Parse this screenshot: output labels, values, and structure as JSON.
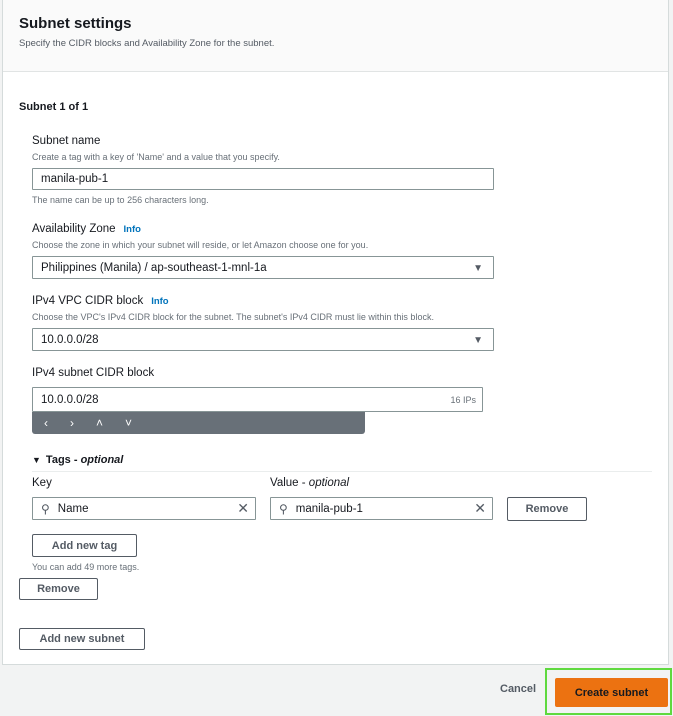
{
  "header": {
    "title": "Subnet settings",
    "description": "Specify the CIDR blocks and Availability Zone for the subnet."
  },
  "subnet": {
    "heading": "Subnet 1 of 1",
    "name": {
      "label": "Subnet name",
      "description": "Create a tag with a key of 'Name' and a value that you specify.",
      "value": "manila-pub-1",
      "hint": "The name can be up to 256 characters long."
    },
    "az": {
      "label": "Availability Zone",
      "info": "Info",
      "description": "Choose the zone in which your subnet will reside, or let Amazon choose one for you.",
      "value": "Philippines (Manila) / ap-southeast-1-mnl-1a"
    },
    "vpc_cidr": {
      "label": "IPv4 VPC CIDR block",
      "info": "Info",
      "description": "Choose the VPC's IPv4 CIDR block for the subnet. The subnet's IPv4 CIDR must lie within this block.",
      "value": "10.0.0.0/28"
    },
    "subnet_cidr": {
      "label": "IPv4 subnet CIDR block",
      "value": "10.0.0.0/28",
      "ip_count": "16 IPs",
      "toolbar": [
        "‹",
        "›",
        "˄",
        "˅"
      ]
    },
    "tags": {
      "heading": "Tags",
      "heading_suffix": "optional",
      "key_label": "Key",
      "value_label": "Value",
      "value_suffix": "optional",
      "key": "Name",
      "value": "manila-pub-1",
      "remove_label": "Remove",
      "add_label": "Add new tag",
      "hint": "You can add 49 more tags."
    },
    "remove_label": "Remove"
  },
  "add_subnet_label": "Add new subnet",
  "footer": {
    "cancel": "Cancel",
    "create": "Create subnet"
  },
  "colors": {
    "primary": "#ec7211",
    "highlight": "#5fd93f",
    "link": "#0073bb"
  }
}
